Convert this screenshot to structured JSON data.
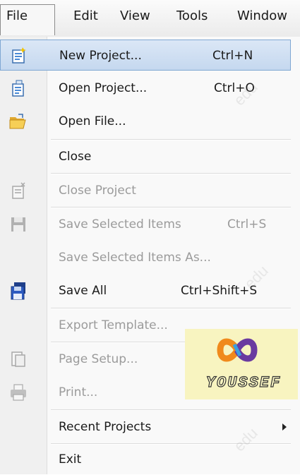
{
  "menubar": {
    "items": [
      {
        "label": "File"
      },
      {
        "label": "Edit"
      },
      {
        "label": "View"
      },
      {
        "label": "Tools"
      },
      {
        "label": "Window"
      }
    ]
  },
  "menu": {
    "items": [
      {
        "label": "New Project...",
        "shortcut": "Ctrl+N",
        "icon": "new-project-icon",
        "enabled": true,
        "highlighted": true
      },
      {
        "label": "Open Project...",
        "shortcut": "Ctrl+O",
        "icon": "open-project-icon",
        "enabled": true
      },
      {
        "label": "Open File...",
        "shortcut": "",
        "icon": "folder-open-icon",
        "enabled": true
      },
      {
        "label": "Close",
        "shortcut": "",
        "icon": "",
        "enabled": true
      },
      {
        "label": "Close Project",
        "shortcut": "",
        "icon": "close-project-icon",
        "enabled": false
      },
      {
        "label": "Save Selected Items",
        "shortcut": "Ctrl+S",
        "icon": "save-icon",
        "enabled": false
      },
      {
        "label": "Save Selected Items As...",
        "shortcut": "",
        "icon": "",
        "enabled": false
      },
      {
        "label": "Save All",
        "shortcut": "Ctrl+Shift+S",
        "icon": "save-all-icon",
        "enabled": true
      },
      {
        "label": "Export Template...",
        "shortcut": "",
        "icon": "",
        "enabled": false
      },
      {
        "label": "Page Setup...",
        "shortcut": "",
        "icon": "page-setup-icon",
        "enabled": false
      },
      {
        "label": "Print...",
        "shortcut": "",
        "icon": "print-icon",
        "enabled": false
      },
      {
        "label": "Recent Projects",
        "shortcut": "",
        "icon": "",
        "enabled": true,
        "submenu": true
      },
      {
        "label": "Exit",
        "shortcut": "",
        "icon": "",
        "enabled": true
      }
    ]
  },
  "logo": {
    "text": "YOUSSEF"
  },
  "colors": {
    "highlight": "#c5d8ef",
    "highlight_border": "#7fa7d3",
    "disabled_text": "#9b9b9b"
  }
}
